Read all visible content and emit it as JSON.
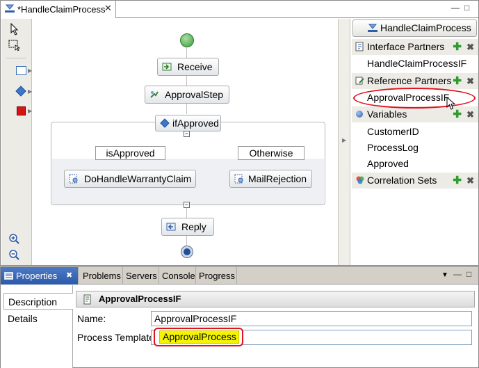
{
  "editor": {
    "tab_title": "*HandleClaimProcess",
    "minimize": "—",
    "maximize": "□"
  },
  "process": {
    "receive": "Receive",
    "approval_step": "ApprovalStep",
    "choice": "ifApproved",
    "case_approved": "isApproved",
    "case_otherwise": "Otherwise",
    "do_handle": "DoHandleWarrantyClaim",
    "mail_rejection": "MailRejection",
    "reply": "Reply",
    "collapse_symbol": "−"
  },
  "tray": {
    "title": "HandleClaimProcess",
    "interface_partners": "Interface Partners",
    "interface_item": "HandleClaimProcessIF",
    "reference_partners": "Reference Partners",
    "reference_item": "ApprovalProcessIF",
    "variables": "Variables",
    "variable_items": [
      "CustomerID",
      "ProcessLog",
      "Approved"
    ],
    "correlation_sets": "Correlation Sets",
    "add_symbol": "✚",
    "remove_symbol": "✖"
  },
  "props": {
    "tabs": [
      "Properties",
      "Problems",
      "Servers",
      "Console",
      "Progress"
    ],
    "tab_close": "✖",
    "menu_arrow": "▼",
    "left_tabs": [
      "Description",
      "Details"
    ],
    "title": "ApprovalProcessIF",
    "name_label": "Name:",
    "name_value": "ApprovalProcessIF",
    "template_label": "Process Template:",
    "template_value": "ApprovalProcess"
  },
  "colors": {
    "highlight_ring": "#e0121b",
    "highlight_fill": "#f4f400",
    "selection": "#2c5aa8"
  }
}
